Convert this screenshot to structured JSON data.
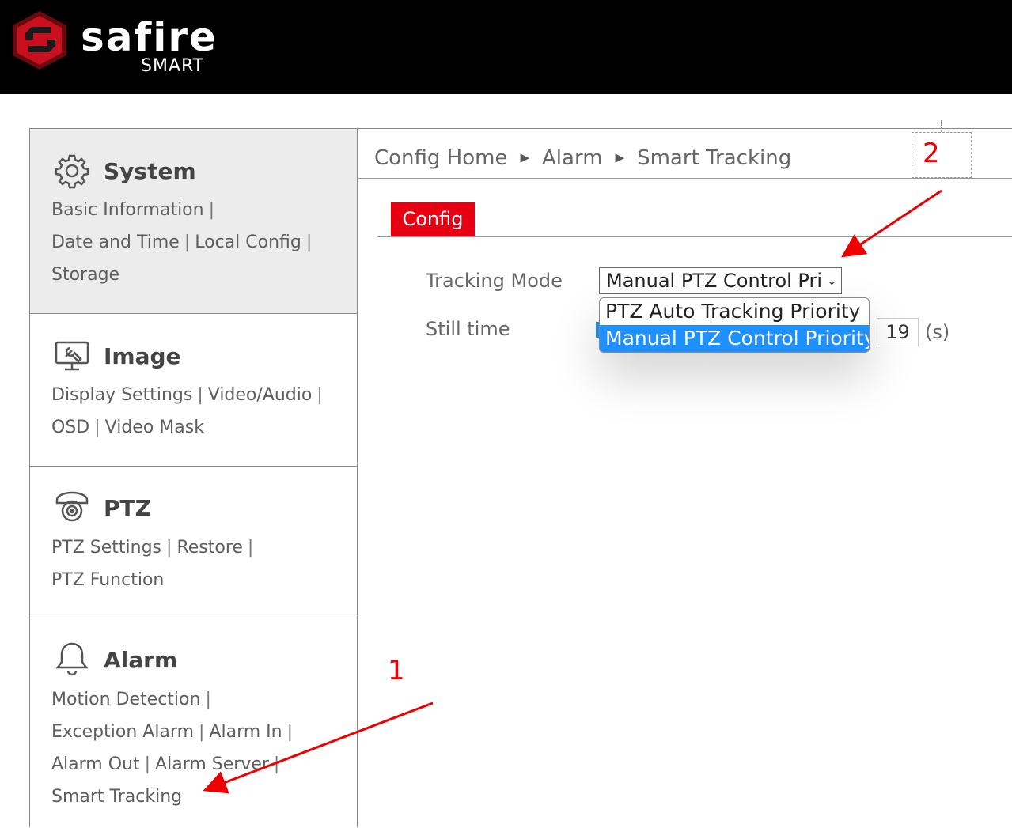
{
  "brand": {
    "name": "safire",
    "sub": "SMART",
    "accent": "#e60012"
  },
  "sidebar": {
    "sections": [
      {
        "title": "System",
        "icon": "gear-icon",
        "links": [
          "Basic Information",
          "Date and Time",
          "Local Config",
          "Storage"
        ]
      },
      {
        "title": "Image",
        "icon": "monitor-icon",
        "links": [
          "Display Settings",
          "Video/Audio",
          "OSD",
          "Video Mask"
        ]
      },
      {
        "title": "PTZ",
        "icon": "ptz-camera-icon",
        "links": [
          "PTZ Settings",
          "Restore",
          "PTZ Function"
        ]
      },
      {
        "title": "Alarm",
        "icon": "bell-icon",
        "links": [
          "Motion Detection",
          "Exception Alarm",
          "Alarm In",
          "Alarm Out",
          "Alarm Server",
          "Smart Tracking"
        ]
      }
    ]
  },
  "breadcrumb": [
    "Config Home",
    "Alarm",
    "Smart Tracking"
  ],
  "tabs": [
    "Config"
  ],
  "form": {
    "tracking_mode_label": "Tracking Mode",
    "tracking_mode_value": "Manual PTZ Control Pri",
    "options": [
      "PTZ Auto Tracking Priority",
      "Manual PTZ Control Priority"
    ],
    "still_time_label": "Still time",
    "still_time_value": "19",
    "still_time_unit": "(s)"
  },
  "annotations": {
    "step1": "1",
    "step2": "2"
  }
}
